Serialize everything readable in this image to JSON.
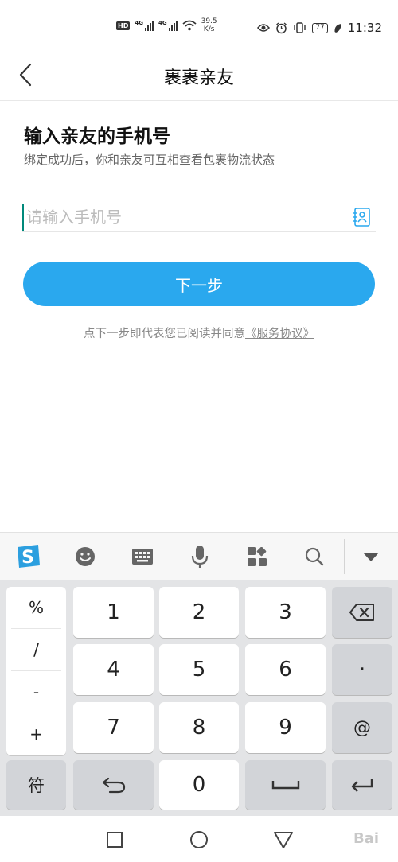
{
  "status_bar": {
    "hd": "HD",
    "net1": "4G",
    "net2": "4G",
    "speed_value": "39.5",
    "speed_unit": "K/s",
    "battery": "77",
    "time": "11:32"
  },
  "header": {
    "title": "裹裹亲友"
  },
  "content": {
    "heading": "输入亲友的手机号",
    "subheading": "绑定成功后，你和亲友可互相查看包裹物流状态",
    "phone_input": {
      "value": "",
      "placeholder": "请输入手机号"
    },
    "next_label": "下一步",
    "agreement_prefix": "点下一步即代表您已阅读并同意",
    "agreement_link": "《服务协议》"
  },
  "keyboard": {
    "symbols": [
      "%",
      "/",
      "-",
      "+"
    ],
    "rows": [
      [
        "1",
        "2",
        "3"
      ],
      [
        "4",
        "5",
        "6"
      ],
      [
        "7",
        "8",
        "9"
      ]
    ],
    "dot": "·",
    "at": "@",
    "fu": "符",
    "zero": "0"
  },
  "icons": {
    "toolbar": [
      "sogou-logo-icon",
      "emoji-icon",
      "keyboard-icon",
      "microphone-icon",
      "grid-apps-icon",
      "search-icon",
      "collapse-keyboard-icon"
    ]
  },
  "colors": {
    "accent": "#2aa8ee",
    "cursor": "#00897b",
    "sogou": "#2c9fdf"
  },
  "watermark": "Bai"
}
